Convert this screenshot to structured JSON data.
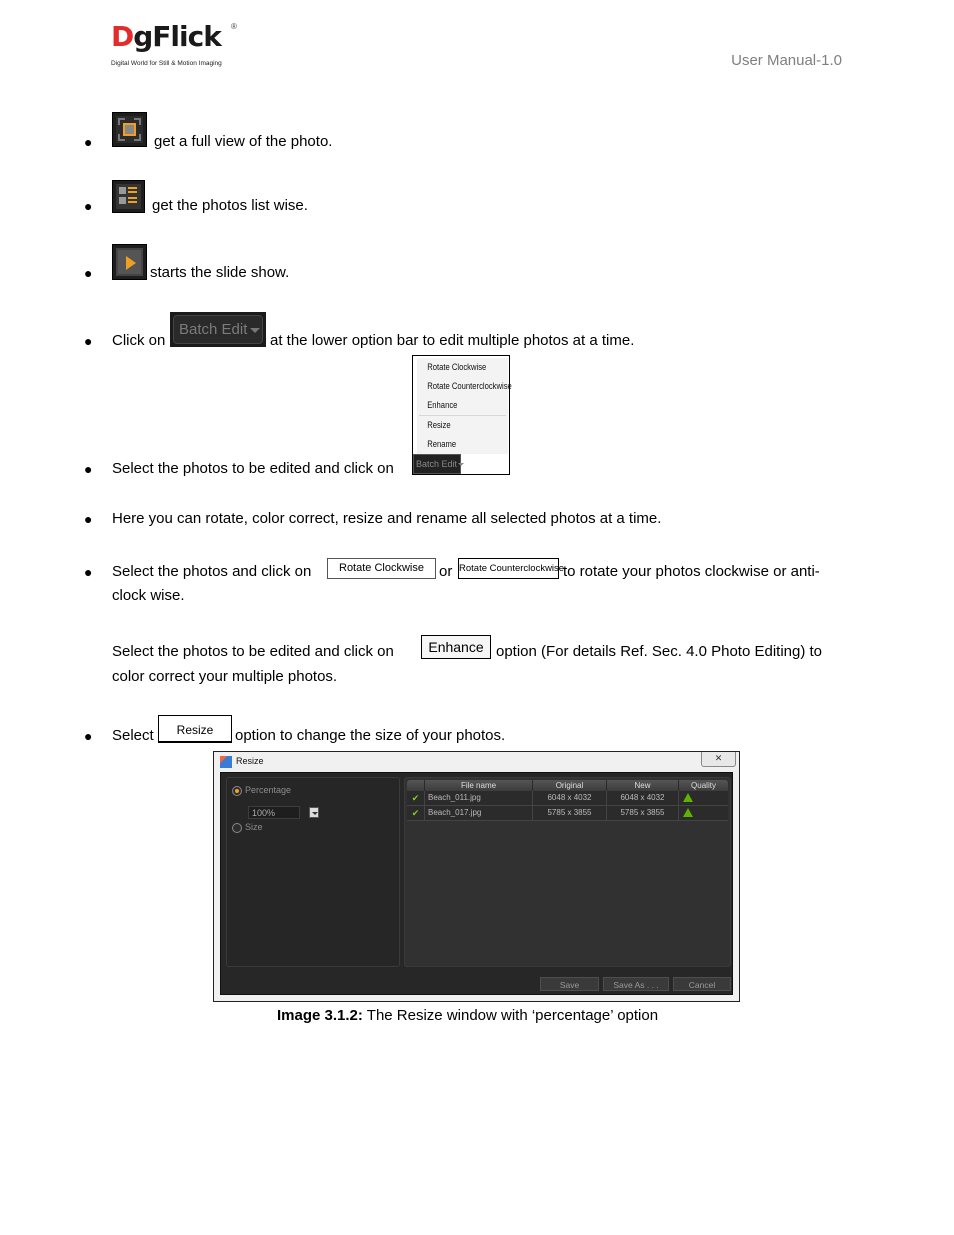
{
  "header": {
    "logo": {
      "brand_first": "D",
      "brand_rest": "gFlick",
      "registered": "®",
      "tagline": "Digital World for Still & Motion Imaging"
    },
    "doc_label": "User Manual-1.0"
  },
  "bullets": [
    {
      "icon": "full-view-icon",
      "text": "get a full view of the photo."
    },
    {
      "icon": "list-view-icon",
      "text": "get the photos list wise."
    },
    {
      "icon": "slideshow-play-icon",
      "text": "starts the slide show."
    },
    {
      "prefix": "Click on",
      "button": "Batch Edit",
      "text": "at the lower option bar to edit multiple photos at a time."
    },
    {
      "text": "Select the photos to be edited and click on"
    },
    {
      "text": "Here you can rotate, color correct, resize and rename all selected photos at a time."
    },
    {
      "prefix": "Select the photos and click on",
      "middle": "or",
      "text_line1": "to rotate your photos clockwise or anti-",
      "text_line2": "clock wise."
    },
    {
      "prefix": "Select",
      "button": "Resize",
      "text": "option to change the size of your photos."
    }
  ],
  "enhance_para": {
    "prefix": "Select the photos to be edited and click on",
    "button": "Enhance",
    "text_line1": "option (For details Ref. Sec. 4.0 Photo Editing) to",
    "text_line2": "color correct your multiple photos."
  },
  "batch_menu": {
    "items": [
      "Rotate Clockwise",
      "Rotate Counterclockwise",
      "Enhance",
      "Resize",
      "Rename"
    ],
    "button": "Batch Edit"
  },
  "inline_buttons": {
    "rotate_cw": "Rotate Clockwise",
    "rotate_ccw": "Rotate Counterclockwise"
  },
  "resize_dialog": {
    "title": "Resize",
    "close": "✕",
    "options": [
      {
        "label": "Percentage",
        "selected": true
      },
      {
        "label": "Size",
        "selected": false
      }
    ],
    "percentage_value": "100%",
    "columns": [
      "",
      "File name",
      "Original",
      "New",
      "Quality"
    ],
    "rows": [
      {
        "checked": true,
        "file": "Beach_011.jpg",
        "original": "6048 x 4032",
        "new": "6048 x 4032",
        "quality": "warning"
      },
      {
        "checked": true,
        "file": "Beach_017.jpg",
        "original": "5785 x 3855",
        "new": "5785 x 3855",
        "quality": "warning"
      }
    ],
    "buttons": {
      "save": "Save",
      "save_as": "Save As . . .",
      "cancel": "Cancel"
    }
  },
  "caption": {
    "label": "Image 3.1.2:",
    "text": " The Resize window with ‘percentage’ option"
  }
}
